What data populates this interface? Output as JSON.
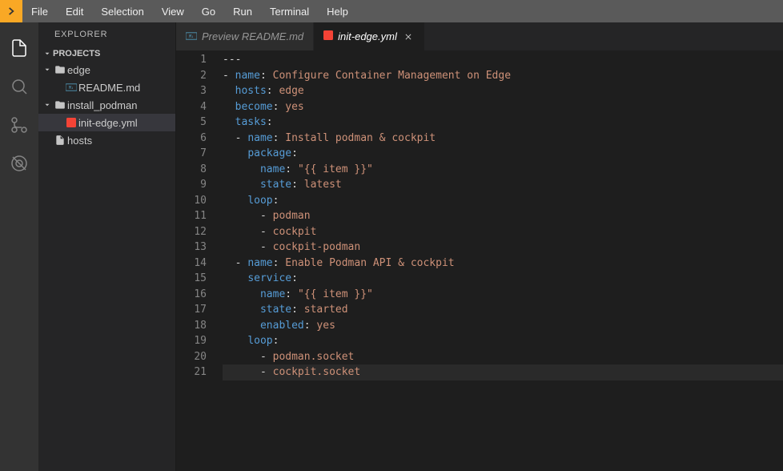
{
  "menubar": {
    "items": [
      "File",
      "Edit",
      "Selection",
      "View",
      "Go",
      "Run",
      "Terminal",
      "Help"
    ]
  },
  "sidebar": {
    "title": "EXPLORER",
    "section": "PROJECTS",
    "tree": [
      {
        "label": "edge",
        "type": "folder",
        "indent": 0,
        "open": true
      },
      {
        "label": "README.md",
        "type": "md",
        "indent": 1
      },
      {
        "label": "install_podman",
        "type": "folder",
        "indent": 0,
        "open": true
      },
      {
        "label": "init-edge.yml",
        "type": "yml",
        "indent": 1,
        "selected": true
      },
      {
        "label": "hosts",
        "type": "file",
        "indent": 0
      }
    ]
  },
  "tabs": [
    {
      "label": "Preview README.md",
      "icon": "md",
      "active": false
    },
    {
      "label": "init-edge.yml",
      "icon": "yml",
      "active": true,
      "closeable": true
    }
  ],
  "code": {
    "lines": [
      {
        "n": 1,
        "segs": [
          {
            "c": "punc",
            "t": "---"
          }
        ]
      },
      {
        "n": 2,
        "segs": [
          {
            "c": "dash",
            "t": "- "
          },
          {
            "c": "yml",
            "t": "name"
          },
          {
            "c": "punc",
            "t": ": "
          },
          {
            "c": "str",
            "t": "Configure Container Management on Edge"
          }
        ]
      },
      {
        "n": 3,
        "segs": [
          {
            "c": "punc",
            "t": "  "
          },
          {
            "c": "yml",
            "t": "hosts"
          },
          {
            "c": "punc",
            "t": ": "
          },
          {
            "c": "str",
            "t": "edge"
          }
        ]
      },
      {
        "n": 4,
        "segs": [
          {
            "c": "punc",
            "t": "  "
          },
          {
            "c": "yml",
            "t": "become"
          },
          {
            "c": "punc",
            "t": ": "
          },
          {
            "c": "str",
            "t": "yes"
          }
        ]
      },
      {
        "n": 5,
        "segs": [
          {
            "c": "punc",
            "t": "  "
          },
          {
            "c": "yml",
            "t": "tasks"
          },
          {
            "c": "punc",
            "t": ":"
          }
        ]
      },
      {
        "n": 6,
        "segs": [
          {
            "c": "punc",
            "t": "  "
          },
          {
            "c": "dash",
            "t": "- "
          },
          {
            "c": "yml",
            "t": "name"
          },
          {
            "c": "punc",
            "t": ": "
          },
          {
            "c": "str",
            "t": "Install podman & cockpit"
          }
        ]
      },
      {
        "n": 7,
        "segs": [
          {
            "c": "punc",
            "t": "    "
          },
          {
            "c": "yml",
            "t": "package"
          },
          {
            "c": "punc",
            "t": ":"
          }
        ]
      },
      {
        "n": 8,
        "segs": [
          {
            "c": "punc",
            "t": "      "
          },
          {
            "c": "yml",
            "t": "name"
          },
          {
            "c": "punc",
            "t": ": "
          },
          {
            "c": "str",
            "t": "\"{{ item }}\""
          }
        ]
      },
      {
        "n": 9,
        "segs": [
          {
            "c": "punc",
            "t": "      "
          },
          {
            "c": "yml",
            "t": "state"
          },
          {
            "c": "punc",
            "t": ": "
          },
          {
            "c": "str",
            "t": "latest"
          }
        ]
      },
      {
        "n": 10,
        "segs": [
          {
            "c": "punc",
            "t": "    "
          },
          {
            "c": "yml",
            "t": "loop"
          },
          {
            "c": "punc",
            "t": ":"
          }
        ]
      },
      {
        "n": 11,
        "segs": [
          {
            "c": "punc",
            "t": "      "
          },
          {
            "c": "dash",
            "t": "- "
          },
          {
            "c": "str",
            "t": "podman"
          }
        ]
      },
      {
        "n": 12,
        "segs": [
          {
            "c": "punc",
            "t": "      "
          },
          {
            "c": "dash",
            "t": "- "
          },
          {
            "c": "str",
            "t": "cockpit"
          }
        ]
      },
      {
        "n": 13,
        "segs": [
          {
            "c": "punc",
            "t": "      "
          },
          {
            "c": "dash",
            "t": "- "
          },
          {
            "c": "str",
            "t": "cockpit-podman"
          }
        ]
      },
      {
        "n": 14,
        "segs": [
          {
            "c": "punc",
            "t": "  "
          },
          {
            "c": "dash",
            "t": "- "
          },
          {
            "c": "yml",
            "t": "name"
          },
          {
            "c": "punc",
            "t": ": "
          },
          {
            "c": "str",
            "t": "Enable Podman API & cockpit"
          }
        ]
      },
      {
        "n": 15,
        "segs": [
          {
            "c": "punc",
            "t": "    "
          },
          {
            "c": "yml",
            "t": "service"
          },
          {
            "c": "punc",
            "t": ":"
          }
        ]
      },
      {
        "n": 16,
        "segs": [
          {
            "c": "punc",
            "t": "      "
          },
          {
            "c": "yml",
            "t": "name"
          },
          {
            "c": "punc",
            "t": ": "
          },
          {
            "c": "str",
            "t": "\"{{ item }}\""
          }
        ]
      },
      {
        "n": 17,
        "segs": [
          {
            "c": "punc",
            "t": "      "
          },
          {
            "c": "yml",
            "t": "state"
          },
          {
            "c": "punc",
            "t": ": "
          },
          {
            "c": "str",
            "t": "started"
          }
        ]
      },
      {
        "n": 18,
        "segs": [
          {
            "c": "punc",
            "t": "      "
          },
          {
            "c": "yml",
            "t": "enabled"
          },
          {
            "c": "punc",
            "t": ": "
          },
          {
            "c": "str",
            "t": "yes"
          }
        ]
      },
      {
        "n": 19,
        "segs": [
          {
            "c": "punc",
            "t": "    "
          },
          {
            "c": "yml",
            "t": "loop"
          },
          {
            "c": "punc",
            "t": ":"
          }
        ]
      },
      {
        "n": 20,
        "segs": [
          {
            "c": "punc",
            "t": "      "
          },
          {
            "c": "dash",
            "t": "- "
          },
          {
            "c": "str",
            "t": "podman.socket"
          }
        ]
      },
      {
        "n": 21,
        "hl": true,
        "segs": [
          {
            "c": "punc",
            "t": "      "
          },
          {
            "c": "dash",
            "t": "- "
          },
          {
            "c": "str",
            "t": "cockpit.socket"
          }
        ]
      }
    ]
  }
}
